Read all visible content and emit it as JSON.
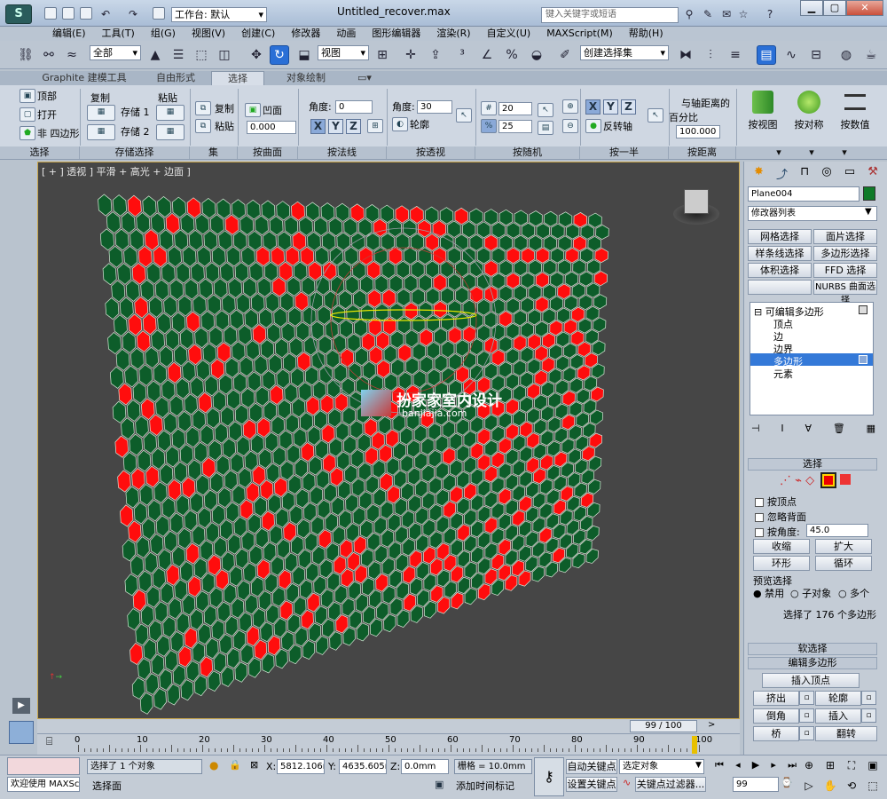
{
  "window": {
    "title": "Untitled_recover.max",
    "workspace": "工作台: 默认",
    "search_placeholder": "键入关键字或短语",
    "minimize": "▁",
    "maximize": "▢",
    "close": "✕"
  },
  "menu": [
    "编辑(E)",
    "工具(T)",
    "组(G)",
    "视图(V)",
    "创建(C)",
    "修改器",
    "动画",
    "图形编辑器",
    "渲染(R)",
    "自定义(U)",
    "MAXScript(M)",
    "帮助(H)"
  ],
  "toolbar": {
    "filter": "全部",
    "view": "视图",
    "selection_set": "创建选择集"
  },
  "ribbon": {
    "tabs": [
      "Graphite 建模工具",
      "自由形式",
      "选择",
      "对象绘制"
    ],
    "select": {
      "top": "顶部",
      "open": "打开",
      "nonquad": "非 四边形",
      "label": "选择"
    },
    "store": {
      "copy": "复制",
      "paste": "粘贴",
      "store1": "存储 1",
      "store2": "存储 2",
      "label": "存储选择"
    },
    "set": {
      "copy": "复制",
      "paste": "粘贴",
      "label": "集"
    },
    "surface": {
      "concave": "凹面",
      "value": "0.000",
      "label": "按曲面"
    },
    "normal": {
      "angle_label": "角度:",
      "angle": "0",
      "x": "X",
      "y": "Y",
      "z": "Z",
      "label": "按法线"
    },
    "perspective": {
      "angle_label": "角度:",
      "angle": "30",
      "outline": "轮廓",
      "label": "按透视"
    },
    "random": {
      "v1": "20",
      "v2": "25",
      "label": "按随机"
    },
    "half": {
      "x": "X",
      "y": "Y",
      "z": "Z",
      "flip": "反转轴",
      "label": "按一半"
    },
    "distance": {
      "title1": "与轴距离的",
      "title2": "百分比",
      "value": "100.000",
      "label": "按距离"
    },
    "big": [
      "按视图",
      "按对称",
      "按数值"
    ]
  },
  "viewport": {
    "label": "[ + ] 透视 ] 平滑 + 高光 + 边面 ]",
    "watermark_cn": "扮家家室内设计",
    "watermark_url": "banjiajia.com"
  },
  "panel": {
    "object_name": "Plane004",
    "modifier_list": "修改器列表",
    "mod_buttons": [
      "网格选择",
      "面片选择",
      "样条线选择",
      "多边形选择",
      "体积选择",
      "FFD 选择",
      "",
      "NURBS 曲面选择"
    ],
    "stack": {
      "root": "可编辑多边形",
      "items": [
        "顶点",
        "边",
        "边界",
        "多边形",
        "元素"
      ]
    },
    "select_roll": "选择",
    "by_vertex": "按顶点",
    "ignore_back": "忽略背面",
    "by_angle": "按角度:",
    "angle_val": "45.0",
    "shrink": "收缩",
    "grow": "扩大",
    "ring": "环形",
    "loop": "循环",
    "preview_label": "预览选择",
    "disabled": "禁用",
    "subobj": "子对象",
    "multi": "多个",
    "selected_info": "选择了 176 个多边形",
    "soft_roll": "软选择",
    "edit_poly_roll": "编辑多边形",
    "insert_vertex": "插入顶点",
    "extrude": "挤出",
    "outline": "轮廓",
    "bevel": "倒角",
    "inset": "插入",
    "bridge": "桥",
    "flip": "翻转"
  },
  "timeline": {
    "frame": "99 / 100",
    "ticks": [
      "0",
      "10",
      "20",
      "30",
      "40",
      "50",
      "60",
      "70",
      "80",
      "90",
      "100"
    ]
  },
  "status": {
    "welcome": "欢迎使用 MAXSc",
    "selected": "选择了 1 个对象",
    "prompt": "选择面",
    "x_label": "X:",
    "x": "5812.106m",
    "y_label": "Y:",
    "y": "4635.605m",
    "z_label": "Z:",
    "z": "0.0mm",
    "grid": "栅格 = 10.0mm",
    "add_time_tag": "添加时间标记",
    "auto_key": "自动关键点",
    "set_key": "设置关键点",
    "selected_obj": "选定对象",
    "key_filter": "关键点过滤器...",
    "frame_field": "99"
  },
  "colors": {
    "hex_green": "#0d5d2a",
    "hex_red": "#ff0d0d",
    "viewport_bg": "#464646"
  }
}
